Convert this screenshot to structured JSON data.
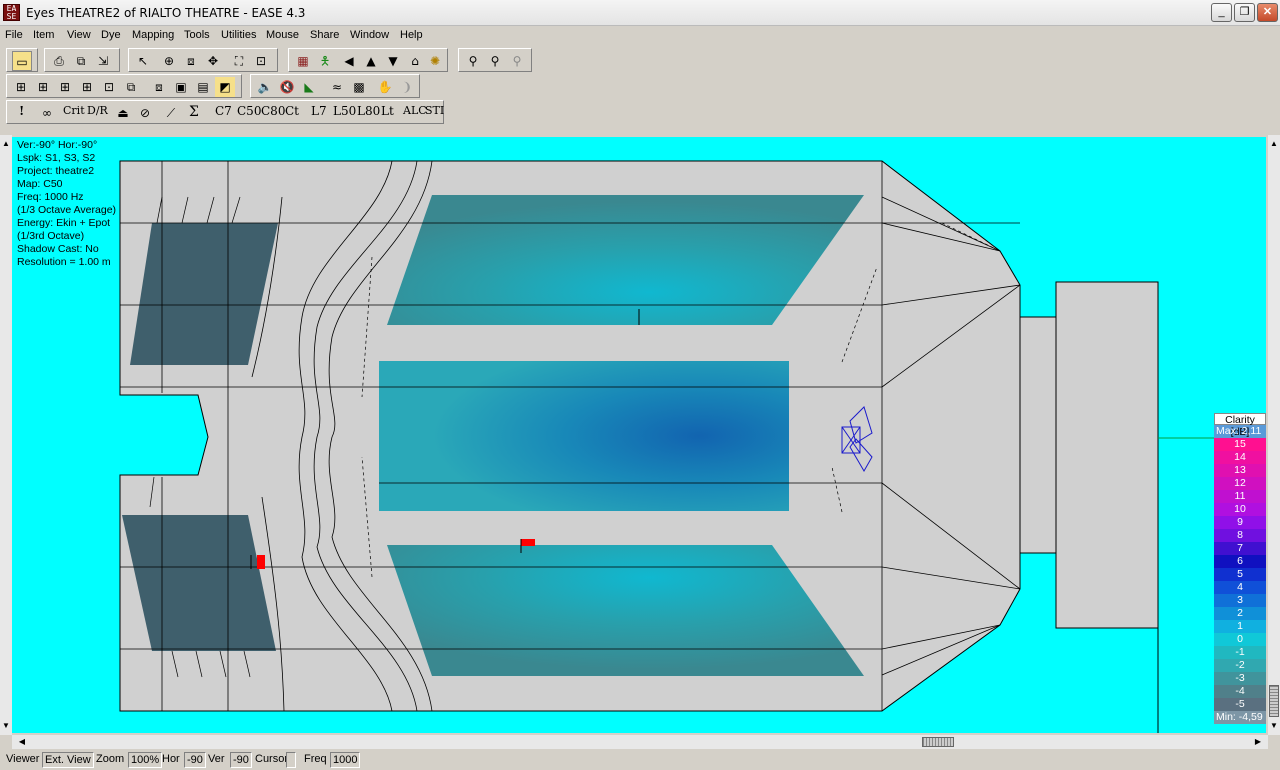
{
  "window": {
    "title": "Eyes THEATRE2 of RIALTO THEATRE - EASE 4.3",
    "icon": "ease-app-icon",
    "minimize": "_",
    "maximize": "❐",
    "close": "✕"
  },
  "menu": [
    "File",
    "Item",
    "View",
    "Dye",
    "Mapping",
    "Tools",
    "Utilities",
    "Mouse",
    "Share",
    "Window",
    "Help"
  ],
  "toolbar3_labels": [
    "!",
    "Crit",
    "D/R",
    "Σ",
    "C7",
    "C50",
    "C80",
    "Ct",
    "L7",
    "L50",
    "L80",
    "Lt",
    "ALC",
    "STI"
  ],
  "info": {
    "lines": [
      "Ver:-90°   Hor:-90°",
      "Lspk: S1, S3, S2",
      "Project: theatre2",
      "Map: C50",
      "Freq: 1000 Hz",
      "(1/3 Octave Average)",
      "Energy: Ekin + Epot",
      "(1/3rd Octave)",
      "Shadow Cast: No",
      "Resolution =   1.00 m"
    ]
  },
  "legend": {
    "title": "Clarity [dB]",
    "max_label": "Max:  2,11",
    "min_label": "Min:  -4,59",
    "levels": [
      {
        "label": "15",
        "color": "#ff1090"
      },
      {
        "label": "14",
        "color": "#f010a0"
      },
      {
        "label": "13",
        "color": "#e010b0"
      },
      {
        "label": "12",
        "color": "#d010c0"
      },
      {
        "label": "11",
        "color": "#c010d0"
      },
      {
        "label": "10",
        "color": "#b010e0"
      },
      {
        "label": "9",
        "color": "#9010e8"
      },
      {
        "label": "8",
        "color": "#7010e0"
      },
      {
        "label": "7",
        "color": "#4010d0"
      },
      {
        "label": "6",
        "color": "#1010c0"
      },
      {
        "label": "5",
        "color": "#1030d0"
      },
      {
        "label": "4",
        "color": "#1050d8"
      },
      {
        "label": "3",
        "color": "#1070d8"
      },
      {
        "label": "2",
        "color": "#1090d8"
      },
      {
        "label": "1",
        "color": "#10b0e0"
      },
      {
        "label": "0",
        "color": "#10c8d8"
      },
      {
        "label": "-1",
        "color": "#20b8c0"
      },
      {
        "label": "-2",
        "color": "#30a8b0"
      },
      {
        "label": "-3",
        "color": "#40949c"
      },
      {
        "label": "-4",
        "color": "#50808a"
      },
      {
        "label": "-5",
        "color": "#5a7080"
      }
    ]
  },
  "status": {
    "viewer": "Viewer",
    "ext_view": "Ext. View",
    "zoom_label": "Zoom",
    "zoom_value": "100%",
    "hor_label": "Hor",
    "hor_value": "-90",
    "ver_label": "Ver",
    "ver_value": "-90",
    "cursor_label": "Cursor",
    "freq_label": "Freq",
    "freq_value": "1000"
  },
  "colors": {
    "canvas": "#00ffff",
    "floor": "#d0d0d0",
    "seats_dark": "#3f5f6c"
  }
}
